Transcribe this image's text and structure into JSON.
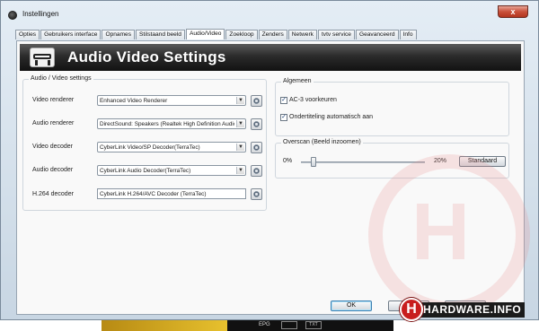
{
  "window": {
    "title": "Instellingen",
    "close_glyph": "x"
  },
  "tabs": [
    {
      "label": "Opties"
    },
    {
      "label": "Gebruikers interface"
    },
    {
      "label": "Opnames"
    },
    {
      "label": "Stilstaand beeld"
    },
    {
      "label": "Audio/Video"
    },
    {
      "label": "Zoekloop"
    },
    {
      "label": "Zenders"
    },
    {
      "label": "Netwerk"
    },
    {
      "label": "tvtv service"
    },
    {
      "label": "Geavanceerd"
    },
    {
      "label": "Info"
    }
  ],
  "active_tab": "Audio/Video",
  "banner": {
    "title": "Audio Video Settings",
    "icon": "monitor-stand-icon"
  },
  "av_settings": {
    "group_title": "Audio / Video settings",
    "video_renderer": {
      "label": "Video renderer",
      "value": "Enhanced Video Renderer"
    },
    "audio_renderer": {
      "label": "Audio renderer",
      "value": "DirectSound: Speakers (Realtek High Definition Audio)"
    },
    "video_decoder": {
      "label": "Video decoder",
      "value": "CyberLink Video/SP Decoder(TerraTec)"
    },
    "audio_decoder": {
      "label": "Audio decoder",
      "value": "CyberLink Audio Decoder(TerraTec)"
    },
    "h264_decoder": {
      "label": "H.264 decoder",
      "value": "CyberLink H.264/AVC Decoder (TerraTec)"
    }
  },
  "algemeen": {
    "group_title": "Algemeen",
    "ac3": {
      "label": "AC-3 voorkeuren",
      "checked": true,
      "mark": "✓"
    },
    "subtitles": {
      "label": "Ondertiteling automatisch aan",
      "checked": true,
      "mark": "✓"
    }
  },
  "overscan": {
    "group_title": "Overscan (Beeld inzoomen)",
    "min_label": "0%",
    "max_label": "20%",
    "value_fraction": 0.1,
    "default_button": "Standaard"
  },
  "footer": {
    "ok_label": "OK"
  },
  "taskbar": {
    "epg_label": "EPG",
    "txt_label": "TXT"
  },
  "logo": {
    "letter": "H",
    "text": "HARDWARE.INFO"
  },
  "colors": {
    "banner": "#1a1a1a",
    "close_button": "#c9503a",
    "logo_red": "#c81e1e"
  }
}
